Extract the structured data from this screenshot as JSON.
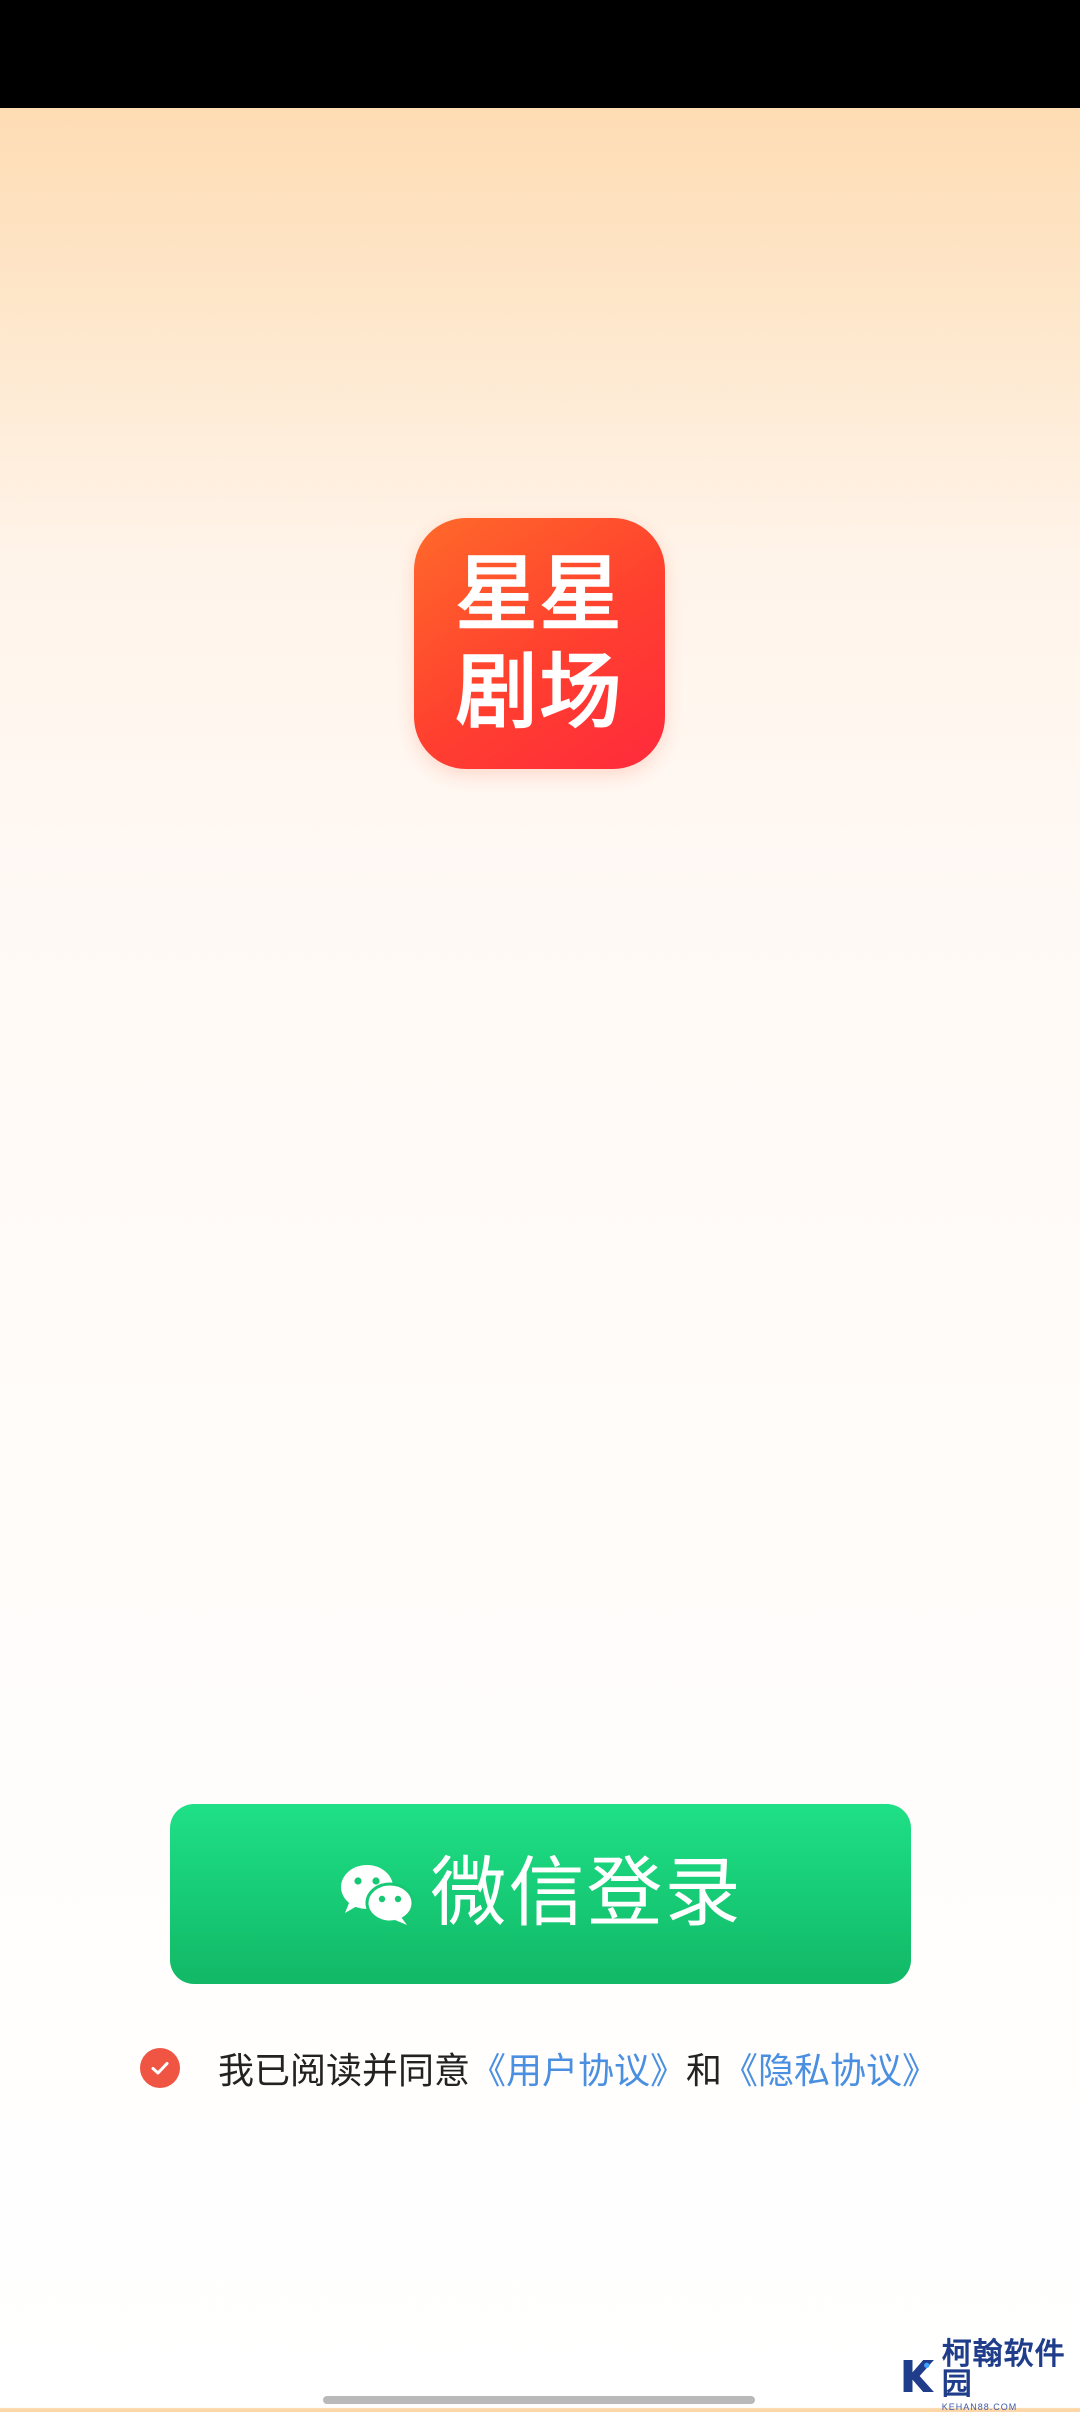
{
  "app": {
    "logo_line1": "星星",
    "logo_line2": "剧场"
  },
  "login": {
    "wechat_button_label": "微信登录"
  },
  "agreement": {
    "checked": true,
    "prefix": "我已阅读并同意",
    "user_agreement": "《用户协议》",
    "conjunction": "和",
    "privacy_agreement": "《隐私协议》"
  },
  "watermark": {
    "name": "柯翰软件园",
    "domain": "KEHAN88.COM"
  },
  "colors": {
    "accent_green": "#16c873",
    "logo_orange": "#ff4a2f",
    "link_blue": "#4a8fe0",
    "check_red": "#f05543"
  },
  "icons": {
    "button_icon": "wechat-icon",
    "checkbox_icon": "check-icon"
  }
}
